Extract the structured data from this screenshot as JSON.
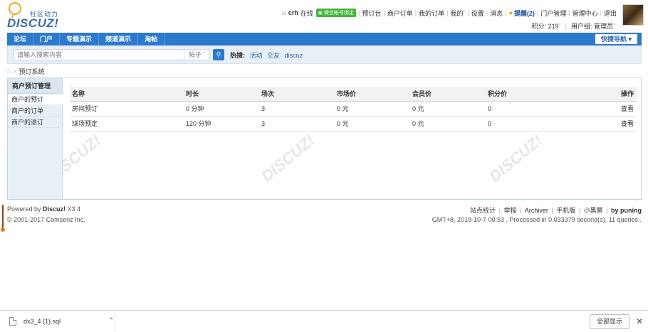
{
  "header": {
    "logo_tag": "社区动力",
    "logo_word": "DISCUZ!",
    "user": {
      "name": "crh",
      "status": "在线",
      "wechat_badge": "微信帐号绑定"
    },
    "links": [
      "预订台",
      "商户订单",
      "我的订单",
      "我的",
      "设置",
      "消息"
    ],
    "remind": "提醒(2)",
    "admin_links": [
      "门户管理",
      "管理中心",
      "退出"
    ],
    "points": "积分: 219",
    "user_group": "用户组: 管理员"
  },
  "nav": {
    "items": [
      "论坛",
      "门户",
      "专题演示",
      "频道演示",
      "淘帖"
    ],
    "quick_nav": "快捷导航"
  },
  "search": {
    "placeholder": "请输入搜索内容",
    "type": "帖子",
    "hot_label": "热搜:",
    "hot_words": [
      "活动",
      "交友",
      "discuz"
    ]
  },
  "breadcrumb": {
    "current": "预订系统"
  },
  "sidebar": {
    "title": "商户预订管理",
    "items": [
      "商户的预订",
      "商户的订单",
      "商户的退订"
    ]
  },
  "table": {
    "headers": [
      "名称",
      "时长",
      "场次",
      "市场价",
      "会员价",
      "积分价",
      "操作"
    ],
    "rows": [
      [
        "房间预订",
        "0 分钟",
        "3",
        "0 元",
        "0 元",
        "0",
        "查看"
      ],
      [
        "球场预定",
        "120 分钟",
        "3",
        "0 元",
        "0 元",
        "0",
        "查看"
      ]
    ]
  },
  "footer": {
    "powered_prefix": "Powered by ",
    "powered_brand": "Discuz!",
    "version": " X3.4",
    "copyright": "© 2001-2017 Comsenz Inc.",
    "links": [
      "站点统计",
      "举报",
      "Archiver",
      "手机版",
      "小黑屋"
    ],
    "by": "by puning",
    "stats": "GMT+8, 2019-10-7 00:53 , Processed in 0.033379 second(s), 11 queries ."
  },
  "download_bar": {
    "file_name": "dx3_4 (1).sql",
    "show_all": "全部显示"
  },
  "colors": {
    "nav_blue": "#2b7acd",
    "link_blue": "#2b6cb0",
    "wechat_green": "#42b53b"
  }
}
